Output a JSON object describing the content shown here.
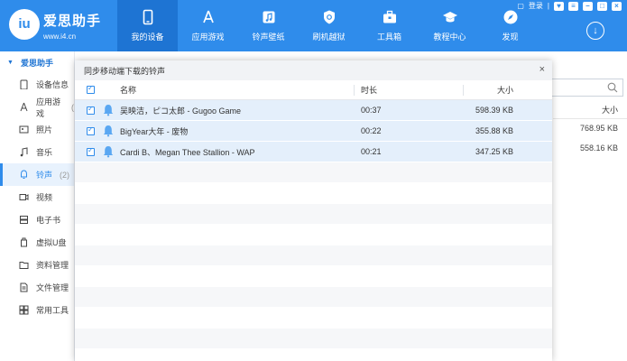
{
  "app": {
    "brand_name": "爱思助手",
    "brand_url": "www.i4.cn",
    "logo_text": "iu"
  },
  "window_controls": {
    "login": "登录"
  },
  "nav": [
    {
      "label": "我的设备",
      "icon": "phone-icon",
      "active": true
    },
    {
      "label": "应用游戏",
      "icon": "app-store-icon",
      "active": false
    },
    {
      "label": "铃声壁纸",
      "icon": "music-note-icon",
      "active": false
    },
    {
      "label": "刷机越狱",
      "icon": "shield-icon",
      "active": false
    },
    {
      "label": "工具箱",
      "icon": "toolbox-icon",
      "active": false
    },
    {
      "label": "教程中心",
      "icon": "graduation-cap-icon",
      "active": false
    },
    {
      "label": "发现",
      "icon": "compass-icon",
      "active": false
    }
  ],
  "sidebar": {
    "head": "爱思助手",
    "items": [
      {
        "label": "设备信息",
        "icon": "device-info-icon"
      },
      {
        "label": "应用游戏",
        "icon": "apps-icon",
        "count": "(",
        "active": false
      },
      {
        "label": "照片",
        "icon": "photo-icon"
      },
      {
        "label": "音乐",
        "icon": "music-icon"
      },
      {
        "label": "铃声",
        "icon": "bell-icon",
        "count": "(2)",
        "active": true
      },
      {
        "label": "视频",
        "icon": "video-icon"
      },
      {
        "label": "电子书",
        "icon": "book-icon"
      },
      {
        "label": "虚拟U盘",
        "icon": "usb-icon"
      },
      {
        "label": "资料管理",
        "icon": "folder-icon"
      },
      {
        "label": "文件管理",
        "icon": "file-icon"
      },
      {
        "label": "常用工具",
        "icon": "tools-icon"
      }
    ]
  },
  "background": {
    "size_header": "大小",
    "sizes": [
      "768.95 KB",
      "558.16 KB"
    ]
  },
  "dialog": {
    "title": "同步移动端下载的铃声",
    "columns": {
      "name": "名称",
      "time": "时长",
      "size": "大小"
    },
    "rows": [
      {
        "name": "吴映洁，ピコ太郎 - Gugoo Game",
        "time": "00:37",
        "size": "598.39 KB"
      },
      {
        "name": "BigYear大年 - 废物",
        "time": "00:22",
        "size": "355.88 KB"
      },
      {
        "name": "Cardi B、Megan Thee Stallion - WAP",
        "time": "00:21",
        "size": "347.25 KB"
      }
    ]
  },
  "colors": {
    "accent": "#2F8CEB",
    "active_nav": "#1E74D3",
    "selected_row": "#E4EFFB"
  }
}
